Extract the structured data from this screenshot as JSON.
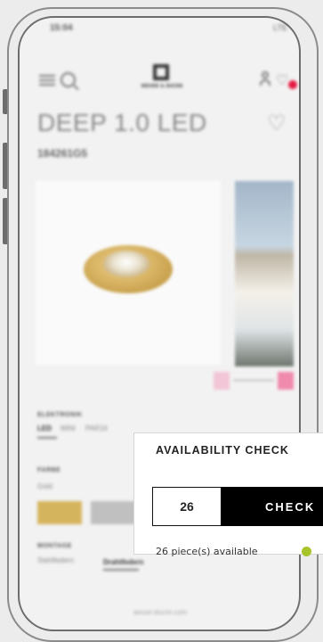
{
  "status_bar": {
    "time": "15:04",
    "network": "LTE"
  },
  "header": {
    "logo_text": "WEVER & DUCRE"
  },
  "product": {
    "title": "DEEP 1.0 LED",
    "code": "184261G5"
  },
  "options": {
    "electronics": {
      "label": "ELEKTRONIK",
      "values": [
        "LED",
        "MINI",
        "PAR16"
      ]
    },
    "color": {
      "label": "FARBE",
      "value": "Gold"
    },
    "mounting": {
      "label": "MONTAGE",
      "values": [
        "Stahlfedern",
        "Drahtfedern"
      ]
    }
  },
  "footer": {
    "url": "wever-ducre.com"
  },
  "popup": {
    "title": "AVAILABILITY CHECK",
    "quantity": "26",
    "button_label": "CHECK",
    "availability_text": "26 piece(s) available",
    "status_color": "#a7c52a"
  },
  "colors": {
    "gold": "#d5b45e",
    "silver": "#c0c0c0",
    "badge": "#e5173f"
  }
}
